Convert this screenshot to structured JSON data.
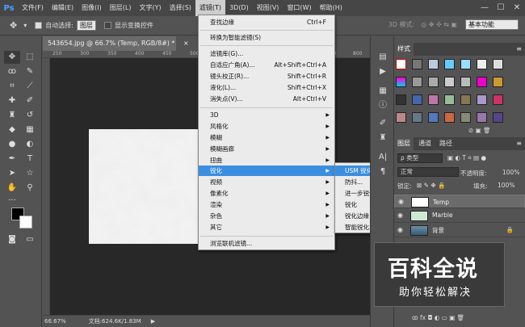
{
  "app": {
    "logo": "Ps"
  },
  "menubar": {
    "items": [
      "文件(F)",
      "编辑(E)",
      "图像(I)",
      "图层(L)",
      "文字(Y)",
      "选择(S)",
      "滤镜(T)",
      "3D(D)",
      "视图(V)",
      "窗口(W)",
      "帮助(H)"
    ],
    "active_index": 6,
    "window_controls": [
      "—",
      "☐",
      "✕"
    ]
  },
  "options": {
    "auto_select": "自动选择:",
    "auto_select_value": "图层",
    "show_transform": "显示变换控件",
    "mode3d": "3D 模式:",
    "workspace": "基本功能"
  },
  "document": {
    "tab": "543654.jpg @ 66.7% (Temp, RGB/8#) *",
    "close": "×",
    "ruler_ticks": [
      "250",
      "300",
      "350",
      "400",
      "450",
      "500",
      "550",
      "600",
      "650",
      "700",
      "750",
      "800"
    ]
  },
  "status": {
    "zoom": "66.67%",
    "doc_size": "文档:624.6K/1.83M"
  },
  "filter_menu": {
    "items": [
      {
        "label": "查找边缘",
        "shortcut": "Ctrl+F"
      },
      {
        "label": "转换为智能滤镜(S)"
      },
      {
        "label": "滤镜库(G)..."
      },
      {
        "label": "自适应广角(A)...",
        "shortcut": "Alt+Shift+Ctrl+A"
      },
      {
        "label": "镜头校正(R)...",
        "shortcut": "Shift+Ctrl+R"
      },
      {
        "label": "液化(L)...",
        "shortcut": "Shift+Ctrl+X"
      },
      {
        "label": "消失点(V)...",
        "shortcut": "Alt+Ctrl+V"
      },
      {
        "label": "3D",
        "arrow": "▶"
      },
      {
        "label": "风格化",
        "arrow": "▶"
      },
      {
        "label": "模糊",
        "arrow": "▶"
      },
      {
        "label": "模糊画廊",
        "arrow": "▶"
      },
      {
        "label": "扭曲",
        "arrow": "▶"
      },
      {
        "label": "锐化",
        "arrow": "▶"
      },
      {
        "label": "视频",
        "arrow": "▶"
      },
      {
        "label": "像素化",
        "arrow": "▶"
      },
      {
        "label": "渲染",
        "arrow": "▶"
      },
      {
        "label": "杂色",
        "arrow": "▶"
      },
      {
        "label": "其它",
        "arrow": "▶"
      },
      {
        "label": "浏览联机滤镜..."
      }
    ]
  },
  "sharpen_submenu": {
    "items": [
      "USM 锐化...",
      "防抖...",
      "进一步锐化",
      "锐化",
      "锐化边缘",
      "智能锐化..."
    ]
  },
  "panels": {
    "styles_tab": "样式",
    "layers_tabs": [
      "图层",
      "通道",
      "路径"
    ],
    "filter_kind": "ρ 类型",
    "blend_mode": "正常",
    "opacity_label": "不透明度:",
    "opacity": "100%",
    "lock_label": "锁定:",
    "fill_label": "填充:",
    "fill": "100%",
    "layers": [
      {
        "name": "Temp"
      },
      {
        "name": "Marble"
      },
      {
        "name": "背景"
      }
    ],
    "bottom_icons": "ꝏ  fx  ◘  ◐  ▭  ▣  🗑"
  },
  "watermark": {
    "title": "百科全说",
    "subtitle": "助你轻松解决"
  },
  "colors": {
    "menu_highlight": "#3b8ee0",
    "app_bg": "#535353",
    "ps_blue": "#4aa3ff"
  }
}
